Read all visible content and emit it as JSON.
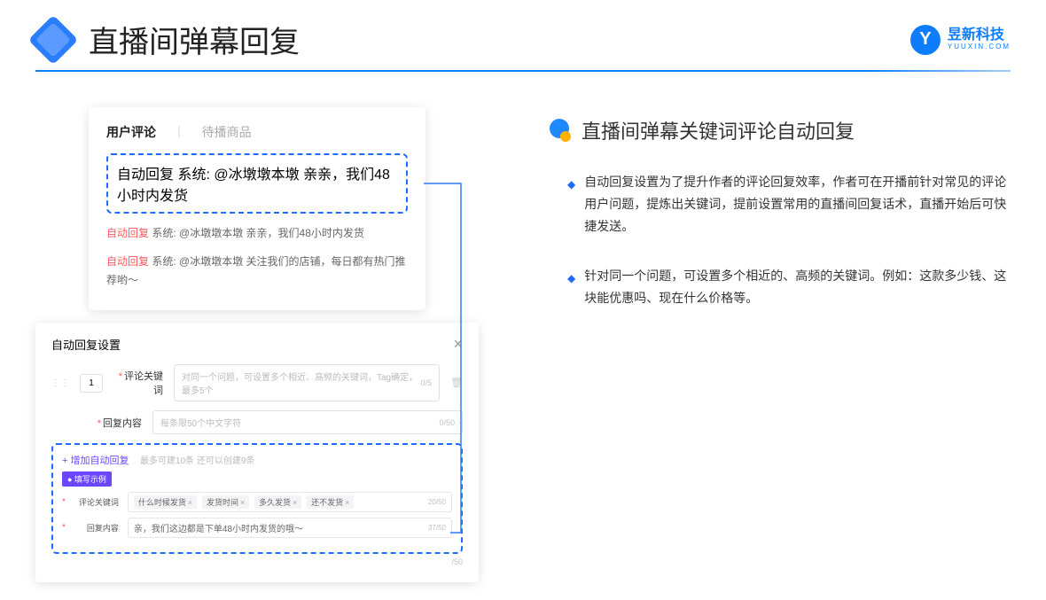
{
  "header": {
    "title": "直播间弹幕回复",
    "brand_cn": "昱新科技",
    "brand_en": "YUUXIN.COM",
    "brand_letter": "Y"
  },
  "card1": {
    "tab1": "用户评论",
    "tab2": "待播商品",
    "highlighted": {
      "tag": "自动回复",
      "prefix": "系统: ",
      "text": "@冰墩墩本墩 亲亲，我们48小时内发货"
    },
    "row2": {
      "tag": "自动回复",
      "prefix": "系统: ",
      "text": "@冰墩墩本墩 亲亲，我们48小时内发货"
    },
    "row3": {
      "tag": "自动回复",
      "prefix": "系统: ",
      "text": "@冰墩墩本墩 关注我们的店铺，每日都有热门推荐哟～"
    }
  },
  "card2": {
    "title": "自动回复设置",
    "num": "1",
    "kw_label": "评论关键词",
    "kw_placeholder": "对同一个问题，可设置多个相近、高频的关键词，Tag确定，最多5个",
    "kw_counter": "0/5",
    "content_label": "回复内容",
    "content_placeholder": "每条限50个中文字符",
    "content_counter": "0/50",
    "add_link": "+ 增加自动回复",
    "add_hint": "最多可建10条 还可以创建9条",
    "example_badge": "● 填写示例",
    "ex_kw_label": "评论关键词",
    "ex_tags": [
      "什么时候发货",
      "发货时间",
      "多久发货",
      "还不发货"
    ],
    "ex_kw_counter": "20/50",
    "ex_content_label": "回复内容",
    "ex_content_text": "亲，我们这边都是下单48小时内发货的哦～",
    "ex_content_counter": "37/50",
    "outer_counter": "/50"
  },
  "right": {
    "section_title": "直播间弹幕关键词评论自动回复",
    "bullet1": "自动回复设置为了提升作者的评论回复效率，作者可在开播前针对常见的评论用户问题，提炼出关键词，提前设置常用的直播间回复话术，直播开始后可快捷发送。",
    "bullet2": "针对同一个问题，可设置多个相近的、高频的关键词。例如：这款多少钱、这块能优惠吗、现在什么价格等。"
  }
}
